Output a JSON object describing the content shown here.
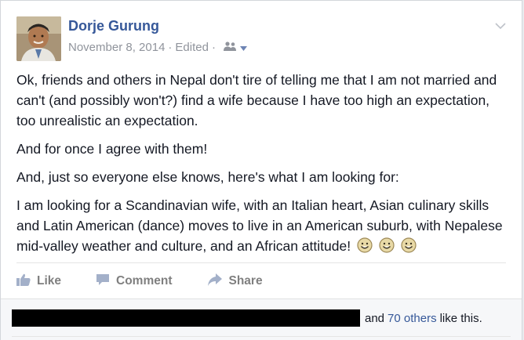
{
  "post": {
    "author": "Dorje Gurung",
    "date": "November 8, 2014",
    "separator": "·",
    "edited": "Edited",
    "paragraphs": [
      "Ok, friends and others in Nepal don't tire of telling me that I am not married and can't (and possibly won't?) find a wife because I have too high an expectation, too unrealistic an expectation.",
      "And for once I agree with them!",
      "And, just so everyone else knows, here's what I am looking for:",
      "I am looking for a Scandinavian wife, with an Italian heart, Asian culinary skills and Latin American (dance) moves to live in an American suburb, with Nepalese mid-valley weather and culture, and an African attitude!"
    ],
    "emoji_count": 3,
    "emoji_icon": "smiley-face-icon"
  },
  "actions": {
    "like": "Like",
    "comment": "Comment",
    "share": "Share"
  },
  "likes": {
    "and": "and",
    "others_link": "70 others",
    "suffix": "like this."
  },
  "colors": {
    "link": "#365899",
    "text": "#141823",
    "meta": "#90949c",
    "action": "#7f7f7f",
    "action_icon": "#a3b0c9"
  }
}
